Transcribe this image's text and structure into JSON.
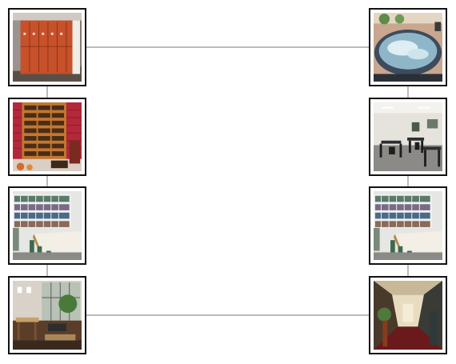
{
  "thumbnails": [
    {
      "name": "locker-room-thumbnail",
      "icon": "locker-room-photo"
    },
    {
      "name": "wine-cellar-thumbnail",
      "icon": "wine-rack-photo"
    },
    {
      "name": "library-left-thumbnail",
      "icon": "library-photo"
    },
    {
      "name": "lounge-thumbnail",
      "icon": "lounge-photo"
    },
    {
      "name": "spa-thumbnail",
      "icon": "hot-tub-photo"
    },
    {
      "name": "cafe-thumbnail",
      "icon": "cafeteria-photo"
    },
    {
      "name": "library-right-thumbnail",
      "icon": "library-photo"
    },
    {
      "name": "hallway-thumbnail",
      "icon": "hallway-photo"
    }
  ],
  "colors": {
    "frame": "#111111",
    "connector": "#777777",
    "background": "#ffffff"
  }
}
